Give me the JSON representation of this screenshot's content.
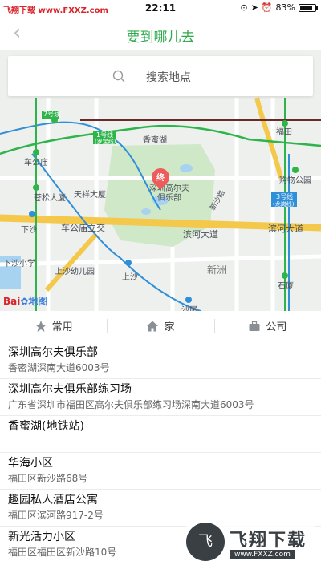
{
  "status_bar": {
    "watermark_brand": "飞翔下载",
    "watermark_site": "www.FXXZ.com",
    "time": "22:11",
    "battery": "83%"
  },
  "nav": {
    "title": "要到哪儿去"
  },
  "search": {
    "placeholder": "搜索地点"
  },
  "map": {
    "marker_label": "终",
    "logo_bai": "Bai",
    "logo_ditu": "地图",
    "labels": {
      "line7": "7号线",
      "line1": "1号线",
      "line1_sub": "(罗宝线)",
      "line3": "3号线",
      "line3_sub": "(龙岗线)",
      "xiangmihu": "香蜜湖",
      "futian": "福田",
      "chegongmiao": "车公庙",
      "tianxiang": "天祥大厦",
      "songsong": "苍松大厦",
      "golf": "深圳高尔夫",
      "golf2": "俱乐部",
      "gouwu": "购物公园",
      "xinsha": "新沙路",
      "chegong_overpass": "车公庙立交",
      "binhe1": "滨河大道",
      "binhe2": "滨河大道",
      "xiasha": "下沙",
      "xiasha_school": "下沙小学",
      "shangsha_kg": "上沙幼儿园",
      "shangsha": "上沙",
      "xinzhou": "新洲",
      "shidai": "石厦",
      "shawei": "沙尾"
    }
  },
  "tabs": [
    {
      "label": "常用",
      "icon": "star-icon"
    },
    {
      "label": "家",
      "icon": "home-icon"
    },
    {
      "label": "公司",
      "icon": "briefcase-icon"
    }
  ],
  "results": [
    {
      "name": "深圳高尔夫俱乐部",
      "address": "香密湖深南大道6003号"
    },
    {
      "name": "深圳高尔夫俱乐部练习场",
      "address": "广东省深圳市福田区高尔夫俱乐部练习场深南大道6003号"
    },
    {
      "name": "香蜜湖(地铁站)",
      "address": ""
    },
    {
      "name": "华海小区",
      "address": "福田区新沙路68号"
    },
    {
      "name": "趣园私人酒店公寓",
      "address": "福田区滨河路917-2号"
    },
    {
      "name": "新光活力小区",
      "address": "福田区福田区新沙路10号"
    }
  ],
  "corner_watermark": {
    "mark": "飞",
    "brand": "飞翔下载",
    "url": "www.FXXZ.com"
  },
  "colors": {
    "accent": "#2eaa4d",
    "metro_green": "#2fb34b",
    "metro_blue": "#2f8fd8",
    "metro_dark": "#6b2a2a",
    "road_yellow": "#f4c84a",
    "park_green": "#cfe8c8"
  }
}
